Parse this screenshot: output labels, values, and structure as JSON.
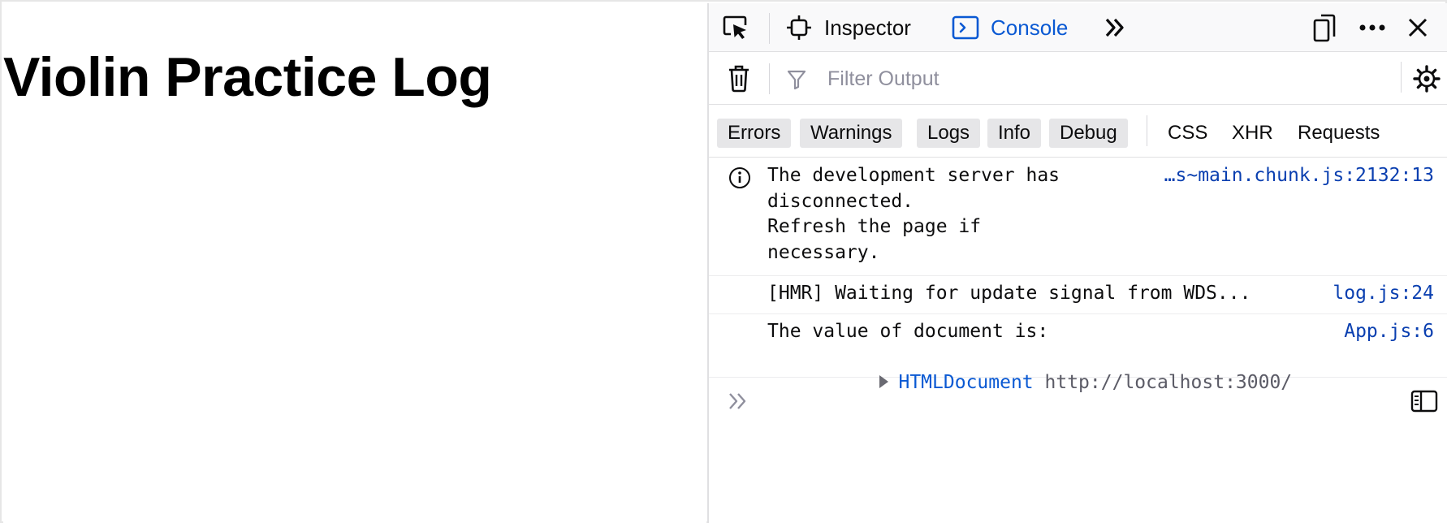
{
  "page": {
    "title": "Violin Practice Log"
  },
  "devtools": {
    "tabs": [
      {
        "label": "Inspector",
        "icon": "inspector-icon"
      },
      {
        "label": "Console",
        "icon": "console-icon",
        "active": true
      }
    ],
    "toolbar": {
      "filter_placeholder": "Filter Output"
    },
    "filters": {
      "levels": [
        "Errors",
        "Warnings",
        "Logs",
        "Info",
        "Debug"
      ],
      "requests": [
        "CSS",
        "XHR",
        "Requests"
      ]
    },
    "messages": [
      {
        "type": "info",
        "lines": [
          "The development server has",
          "disconnected.",
          "Refresh the page if",
          "necessary."
        ],
        "source": "…s~main.chunk.js:2132:13"
      },
      {
        "type": "log",
        "lines": [
          "[HMR] Waiting for update signal from WDS..."
        ],
        "source": "log.js:24"
      },
      {
        "type": "log",
        "lines": [
          "The value of document is:"
        ],
        "object": {
          "kind": "HTMLDocument",
          "value": "http://localhost:3000/"
        },
        "source": "App.js:6"
      }
    ],
    "colors": {
      "accent": "#0a59d3",
      "source_link": "#0a3fb0",
      "toolbar_bg": "#f9f9fa"
    }
  }
}
